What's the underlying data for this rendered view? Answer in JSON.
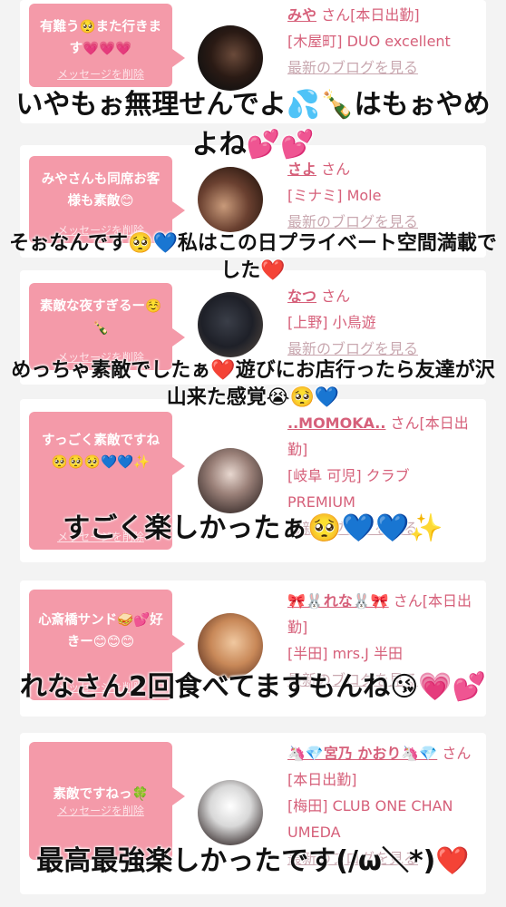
{
  "cards": [
    {
      "message": "有難う🥺また行きます💗💗💗",
      "delete_label": "メッセージを削除",
      "name": "みや",
      "suffix": "さん[本日出勤]",
      "shop": "[木屋町] DUO excellent",
      "blog": "最新のブログを見る"
    },
    {
      "message": "みやさんも同席お客様も素敵😊",
      "delete_label": "メッセージを削除",
      "name": "さよ",
      "suffix": "さん",
      "shop": "[ミナミ] Mole",
      "blog": "最新のブログを見る"
    },
    {
      "message": "素敵な夜すぎるー☺️🍾",
      "delete_label": "メッセージを削除",
      "name": "なつ",
      "suffix": "さん",
      "shop": "[上野] 小鳥遊",
      "blog": "最新のブログを見る"
    },
    {
      "message": "すっごく素敵ですね🥺🥺🥺💙💙✨",
      "delete_label": "メッセージを削除",
      "name": "..MOMOKA..",
      "suffix": "さん[本日出勤]",
      "shop": "[岐阜 可児] クラブ PREMIUM",
      "blog": "最新のブログを見る"
    },
    {
      "message": "心斎橋サンド🥪💕好きー😊😊😊",
      "delete_label": "メッセージを削除",
      "name": "🎀🐰れな🐰🎀",
      "suffix": "さん[本日出勤]",
      "shop": "[半田] mrs.J 半田",
      "blog": "最新のブログを見る"
    },
    {
      "message": "素敵ですねっ🍀",
      "delete_label": "メッセージを削除",
      "name": "🦄💎宮乃 かおり🦄💎",
      "suffix": "さん[本日出勤]",
      "shop": "[梅田] CLUB ONE CHAN UMEDA",
      "blog": "最新のブログを見る"
    }
  ],
  "captions": [
    "いやもぉ無理せんでよ💦🍾はもぉやめよね💕💕",
    "そぉなんです🥺💙私はこの日プライベート空間満載でした❤️",
    "めっちゃ素敵でしたぁ❤️遊びにお店行ったら友達が沢山来た感覚😭🥺💙",
    "すごく楽しかったぁ🥺💙💙✨",
    "れなさん2回食べてますもんね😘💗💕",
    "最高最強楽しかったです(/ω＼*)❤️"
  ]
}
